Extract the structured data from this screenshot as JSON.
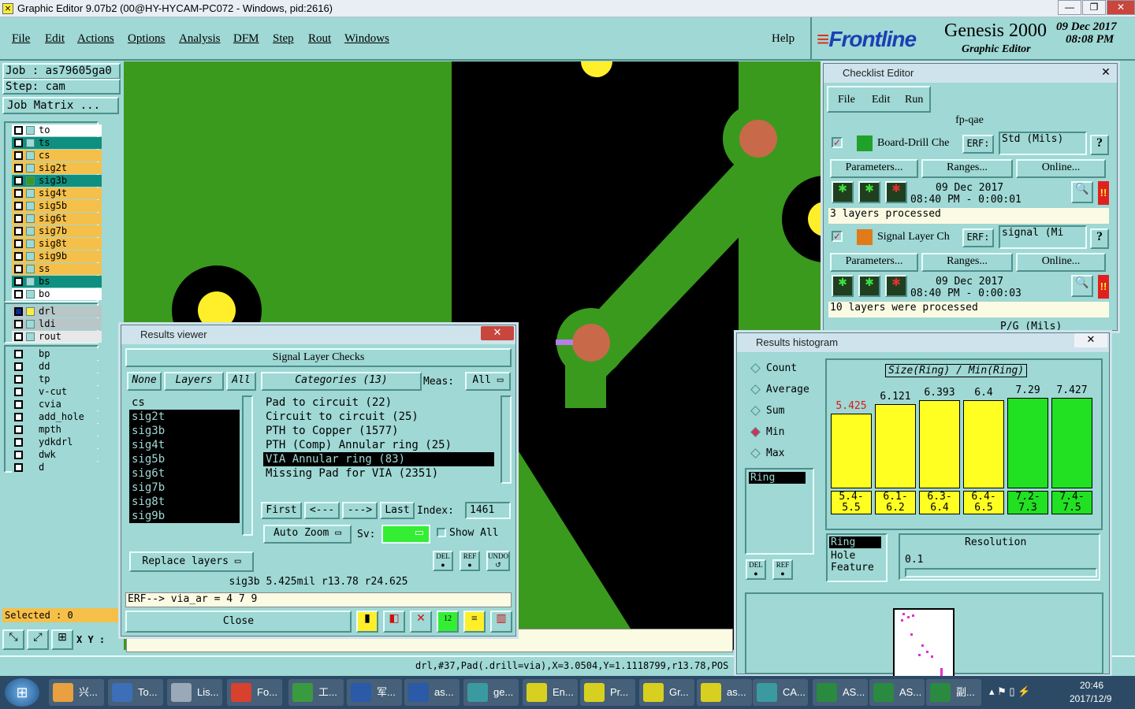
{
  "window": {
    "title": "Graphic Editor 9.07b2 (00@HY-HYCAM-PC072 - Windows, pid:2616)"
  },
  "menu": [
    "File",
    "Edit",
    "Actions",
    "Options",
    "Analysis",
    "DFM",
    "Step",
    "Rout",
    "Windows"
  ],
  "help": "Help",
  "brand": {
    "logo": "Frontline",
    "product": "Genesis 2000",
    "sub": "Graphic Editor",
    "date": "09 Dec 2017",
    "time": "08:08 PM"
  },
  "job": {
    "job": "Job : as79605ga0",
    "step": "Step: cam",
    "matrix": "Job Matrix ..."
  },
  "layers": {
    "board": [
      {
        "n": "to",
        "c": "#ffffff",
        "s": "o"
      },
      {
        "n": "ts",
        "c": "#0f8f7f",
        "s": ""
      },
      {
        "n": "cs",
        "c": "#f5c04a",
        "s": ""
      },
      {
        "n": "sig2t",
        "c": "#f5c04a",
        "s": ""
      },
      {
        "n": "sig3b",
        "c": "#0f8f7f",
        "s": "g"
      },
      {
        "n": "sig4t",
        "c": "#f5c04a",
        "s": ""
      },
      {
        "n": "sig5b",
        "c": "#f5c04a",
        "s": ""
      },
      {
        "n": "sig6t",
        "c": "#f5c04a",
        "s": ""
      },
      {
        "n": "sig7b",
        "c": "#f5c04a",
        "s": ""
      },
      {
        "n": "sig8t",
        "c": "#f5c04a",
        "s": ""
      },
      {
        "n": "sig9b",
        "c": "#f5c04a",
        "s": ""
      },
      {
        "n": "ss",
        "c": "#f5c04a",
        "s": ""
      },
      {
        "n": "bs",
        "c": "#0f8f7f",
        "s": ""
      },
      {
        "n": "bo",
        "c": "#ffffff",
        "s": "o"
      }
    ],
    "drill": [
      {
        "n": "drl",
        "c": "#b8c6c8",
        "s": "b"
      },
      {
        "n": "ldi",
        "c": "#b8c6c8",
        "s": ""
      },
      {
        "n": "rout",
        "c": "#e8e8e8",
        "s": ""
      }
    ],
    "misc": [
      "bp",
      "dd",
      "tp",
      "v-cut",
      "cvia",
      "add_hole",
      "mpth",
      "ydkdrl",
      "dwk",
      "d"
    ]
  },
  "selected": "Selected : 0",
  "xy": "X Y :",
  "status": "drl,#37,Pad(.drill=via),X=3.0504,Y=1.1118799,r13.78,POS",
  "checklist": {
    "title": "Checklist Editor",
    "menu": [
      "File",
      "Edit",
      "Run"
    ],
    "name": "fp-qae",
    "actions": [
      {
        "name": "Board-Drill Che",
        "erf": "ERF:",
        "erfval": "Std (Mils)",
        "date": "09 Dec 2017",
        "time": "08:40 PM - 0:00:01",
        "msg": "3 layers processed"
      },
      {
        "name": "Signal Layer Ch",
        "erf": "ERF:",
        "erfval": "signal (Mi",
        "date": "09 Dec 2017",
        "time": "08:40 PM - 0:00:03",
        "msg": "10 layers were processed"
      }
    ],
    "third_erf": "P/G (Mils)",
    "btns": [
      "Parameters...",
      "Ranges...",
      "Online..."
    ]
  },
  "results": {
    "title": "Results viewer",
    "header": "Signal Layer Checks",
    "none": "None",
    "layers": "Layers",
    "all": "All",
    "categories": "Categories (13)",
    "meas": "Meas:",
    "measval": "All",
    "layerlist": [
      "cs",
      "sig2t",
      "sig3b",
      "sig4t",
      "sig5b",
      "sig6t",
      "sig7b",
      "sig8t",
      "sig9b"
    ],
    "catlist": [
      "Pad to circuit (22)",
      "Circuit to circuit (25)",
      "PTH to Copper (1577)",
      "PTH (Comp) Annular ring (25)",
      "VIA Annular ring (83)",
      "Missing Pad for VIA (2351)"
    ],
    "nav": [
      "First",
      "<---",
      "--->",
      "Last"
    ],
    "index": "Index:",
    "indexval": "1461",
    "autozoom": "Auto Zoom",
    "sv": "Sv:",
    "showall": "Show All",
    "replace": "Replace layers",
    "del": "DEL",
    "ref": "REF",
    "undo": "UNDO",
    "info": "sig3b 5.425mil   r13.78   r24.625",
    "erf": "ERF--> via_ar = 4 7 9",
    "close": "Close"
  },
  "histogram": {
    "title": "Results histogram",
    "heading": "Size(Ring) / Min(Ring)",
    "modes": [
      "Count",
      "Average",
      "Sum",
      "Min",
      "Max"
    ],
    "selected_mode": "Min",
    "list": [
      "Ring"
    ],
    "features": [
      "Ring",
      "Hole",
      "Feature"
    ],
    "resolution": "Resolution",
    "resval": "0.1",
    "bars": [
      {
        "v": "5.425",
        "h": 0.55,
        "c": "#ffff22",
        "red": true,
        "l1": "5.4-",
        "l2": "5.5"
      },
      {
        "v": "6.121",
        "h": 0.62,
        "c": "#ffff22",
        "l1": "6.1-",
        "l2": "6.2"
      },
      {
        "v": "6.393",
        "h": 0.65,
        "c": "#ffff22",
        "l1": "6.3-",
        "l2": "6.4"
      },
      {
        "v": "6.4",
        "h": 0.65,
        "c": "#ffff22",
        "l1": "6.4-",
        "l2": "6.5"
      },
      {
        "v": "7.29",
        "h": 0.75,
        "c": "#22e022",
        "l1": "7.2-",
        "l2": "7.3"
      },
      {
        "v": "7.427",
        "h": 0.76,
        "c": "#22e022",
        "l1": "7.4-",
        "l2": "7.5"
      }
    ],
    "del": "DEL",
    "ref": "REF"
  },
  "taskbar": {
    "time": "20:46",
    "date": "2017/12/9",
    "items": [
      {
        "l": "兴...",
        "c": "#e8a040"
      },
      {
        "l": "To...",
        "c": "#3c6fb8"
      },
      {
        "l": "Lis...",
        "c": "#9aa8b8"
      },
      {
        "l": "Fo...",
        "c": "#d84030"
      },
      {
        "l": "工...",
        "c": "#3a9a40"
      },
      {
        "l": "军...",
        "c": "#2a5aa8"
      },
      {
        "l": "as...",
        "c": "#2a5aa8"
      },
      {
        "l": "ge...",
        "c": "#3a9aa0"
      },
      {
        "l": "En...",
        "c": "#d8d020"
      },
      {
        "l": "Pr...",
        "c": "#d8d020"
      },
      {
        "l": "Gr...",
        "c": "#d8d020"
      },
      {
        "l": "as...",
        "c": "#d8d020"
      },
      {
        "l": "CA...",
        "c": "#3a9aa0"
      },
      {
        "l": "AS...",
        "c": "#2a8a40"
      },
      {
        "l": "AS...",
        "c": "#2a8a40"
      },
      {
        "l": "副...",
        "c": "#2a8a40"
      }
    ]
  }
}
